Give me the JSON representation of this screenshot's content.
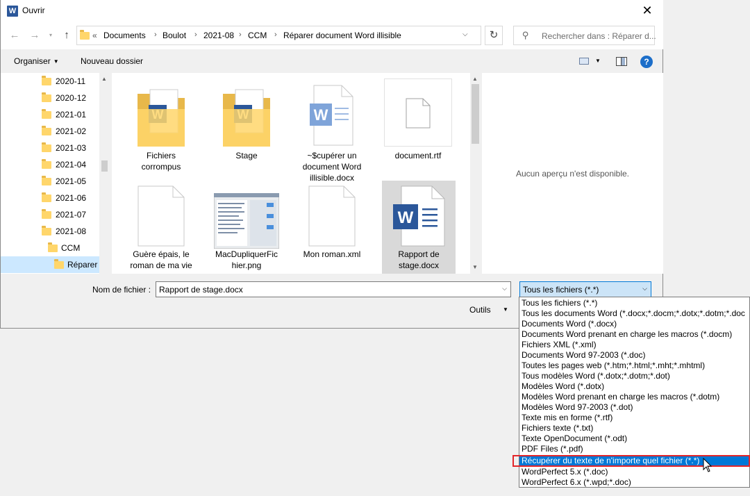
{
  "window": {
    "title": "Ouvrir",
    "app_icon": "W"
  },
  "navigation": {
    "back_icon": "arrow-left-icon",
    "forward_icon": "arrow-right-icon",
    "recent_icon": "chevron-down-icon",
    "up_icon": "arrow-up-icon",
    "address_overflow": "«",
    "breadcrumbs": [
      "Documents",
      "Boulot",
      "2021-08",
      "CCM",
      "Réparer document Word illisible"
    ],
    "search_placeholder": "Rechercher dans : Réparer d..."
  },
  "toolbar": {
    "organize": "Organiser",
    "new_folder": "Nouveau dossier",
    "help": "?"
  },
  "tree": [
    {
      "label": "2020-11"
    },
    {
      "label": "2020-12"
    },
    {
      "label": "2021-01"
    },
    {
      "label": "2021-02"
    },
    {
      "label": "2021-03"
    },
    {
      "label": "2021-04"
    },
    {
      "label": "2021-05"
    },
    {
      "label": "2021-06"
    },
    {
      "label": "2021-07"
    },
    {
      "label": "2021-08"
    },
    {
      "label": "CCM"
    },
    {
      "label": "Réparer d"
    }
  ],
  "files": [
    {
      "name": "Fichiers corrompus",
      "lines": [
        "Fichiers",
        "corrompus"
      ],
      "type": "folder-word"
    },
    {
      "name": "Stage",
      "lines": [
        "Stage"
      ],
      "type": "folder-word"
    },
    {
      "name": "~$cupérer un document Word illisible.docx",
      "lines": [
        "~$cupérer un",
        "document Word",
        "illisible.docx"
      ],
      "type": "word-doc-faded"
    },
    {
      "name": "document.rtf",
      "lines": [
        "document.rtf"
      ],
      "type": "blank-doc"
    },
    {
      "name": "Guère épais, le roman de ma vie",
      "lines": [
        "Guère épais, le",
        "roman de ma vie"
      ],
      "type": "blank-doc"
    },
    {
      "name": "MacDupliquerFichier.png",
      "lines": [
        "MacDupliquerFic",
        "hier.png"
      ],
      "type": "image"
    },
    {
      "name": "Mon roman.xml",
      "lines": [
        "Mon roman.xml"
      ],
      "type": "blank-doc"
    },
    {
      "name": "Rapport de stage.docx",
      "lines": [
        "Rapport de",
        "stage.docx"
      ],
      "type": "word-doc",
      "selected": true
    }
  ],
  "preview": {
    "message": "Aucun aperçu n'est disponible."
  },
  "bottom": {
    "filename_label": "Nom de fichier :",
    "filename_value": "Rapport de stage.docx",
    "filter_value": "Tous les fichiers (*.*)",
    "tools_label": "Outils"
  },
  "filter_options": [
    "Tous les fichiers (*.*)",
    "Tous les documents Word (*.docx;*.docm;*.dotx;*.dotm;*.doc",
    "Documents Word (*.docx)",
    "Documents Word prenant en charge les macros (*.docm)",
    "Fichiers XML (*.xml)",
    "Documents Word 97-2003 (*.doc)",
    "Toutes les pages web (*.htm;*.html;*.mht;*.mhtml)",
    "Tous modèles Word (*.dotx;*.dotm;*.dot)",
    "Modèles Word (*.dotx)",
    "Modèles Word prenant en charge les macros (*.dotm)",
    "Modèles Word 97-2003 (*.dot)",
    "Texte mis en forme (*.rtf)",
    "Fichiers texte (*.txt)",
    "Texte OpenDocument (*.odt)",
    "PDF Files (*.pdf)",
    "Récupérer du texte de n'importe quel fichier (*.*)",
    "WordPerfect 5.x (*.doc)",
    "WordPerfect 6.x (*.wpd;*.doc)"
  ],
  "highlighted_option_index": 15,
  "colors": {
    "accent": "#0078d7",
    "highlight_frame": "#e3262a",
    "word_blue": "#2b579a",
    "folder": "#ffd66b"
  }
}
